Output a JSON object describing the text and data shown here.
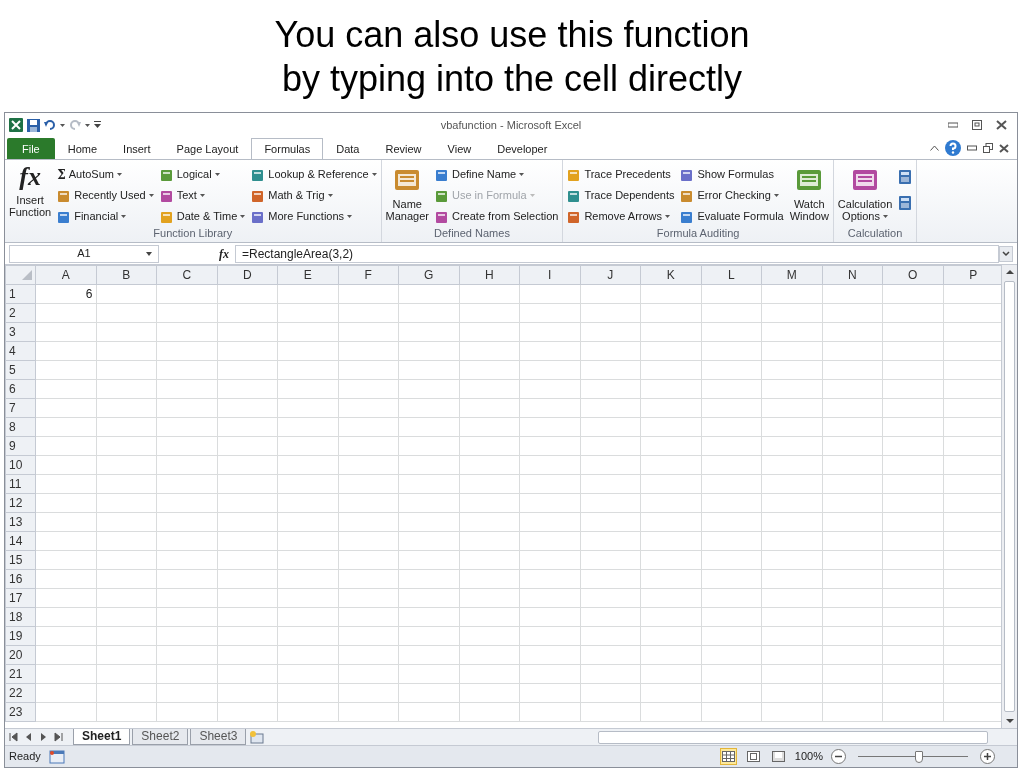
{
  "slide_title_lines": [
    "You can also use this function",
    "by typing into the cell directly"
  ],
  "window": {
    "title": "vbafunction  -  Microsoft Excel"
  },
  "tabs": [
    {
      "label": "File",
      "kind": "file",
      "selected": false
    },
    {
      "label": "Home",
      "kind": "tab",
      "selected": false
    },
    {
      "label": "Insert",
      "kind": "tab",
      "selected": false
    },
    {
      "label": "Page Layout",
      "kind": "tab",
      "selected": false
    },
    {
      "label": "Formulas",
      "kind": "tab",
      "selected": true
    },
    {
      "label": "Data",
      "kind": "tab",
      "selected": false
    },
    {
      "label": "Review",
      "kind": "tab",
      "selected": false
    },
    {
      "label": "View",
      "kind": "tab",
      "selected": false
    },
    {
      "label": "Developer",
      "kind": "tab",
      "selected": false
    }
  ],
  "ribbon_groups": [
    {
      "label": "Function Library",
      "columns": [
        {
          "kind": "large",
          "glyph": "fx",
          "lines": [
            "Insert",
            "Function"
          ],
          "dropdown": false
        },
        {
          "kind": "small",
          "items": [
            {
              "kind": "button",
              "glyph": "Σ",
              "label": "AutoSum",
              "dropdown": true,
              "disabled": false
            },
            {
              "kind": "button",
              "label": "Recently Used",
              "dropdown": true,
              "disabled": false
            },
            {
              "kind": "button",
              "label": "Financial",
              "dropdown": true,
              "disabled": false
            }
          ]
        },
        {
          "kind": "small",
          "items": [
            {
              "kind": "button",
              "label": "Logical",
              "dropdown": true,
              "disabled": false
            },
            {
              "kind": "button",
              "label": "Text",
              "dropdown": true,
              "disabled": false
            },
            {
              "kind": "button",
              "label": "Date & Time",
              "dropdown": true,
              "disabled": false
            }
          ]
        },
        {
          "kind": "small",
          "items": [
            {
              "kind": "button",
              "label": "Lookup & Reference",
              "dropdown": true,
              "disabled": false
            },
            {
              "kind": "button",
              "label": "Math & Trig",
              "dropdown": true,
              "disabled": false
            },
            {
              "kind": "button",
              "label": "More Functions",
              "dropdown": true,
              "disabled": false
            }
          ]
        }
      ]
    },
    {
      "label": "Defined Names",
      "columns": [
        {
          "kind": "large",
          "lines": [
            "Name",
            "Manager"
          ],
          "dropdown": false
        },
        {
          "kind": "small",
          "items": [
            {
              "kind": "button",
              "label": "Define Name",
              "dropdown": true,
              "disabled": false
            },
            {
              "kind": "button",
              "label": "Use in Formula",
              "dropdown": true,
              "disabled": true
            },
            {
              "kind": "button",
              "label": "Create from Selection",
              "dropdown": false,
              "disabled": false
            }
          ]
        }
      ]
    },
    {
      "label": "Formula Auditing",
      "columns": [
        {
          "kind": "small",
          "items": [
            {
              "kind": "button",
              "label": "Trace Precedents",
              "dropdown": false,
              "disabled": false
            },
            {
              "kind": "button",
              "label": "Trace Dependents",
              "dropdown": false,
              "disabled": false
            },
            {
              "kind": "button",
              "label": "Remove Arrows",
              "dropdown": true,
              "disabled": false
            }
          ]
        },
        {
          "kind": "small",
          "items": [
            {
              "kind": "button",
              "label": "Show Formulas",
              "dropdown": false,
              "disabled": false
            },
            {
              "kind": "button",
              "label": "Error Checking",
              "dropdown": true,
              "disabled": false
            },
            {
              "kind": "button",
              "label": "Evaluate Formula",
              "dropdown": false,
              "disabled": false
            }
          ]
        },
        {
          "kind": "large",
          "lines": [
            "Watch",
            "Window"
          ],
          "dropdown": false
        }
      ]
    },
    {
      "label": "Calculation",
      "columns": [
        {
          "kind": "large",
          "lines": [
            "Calculation",
            "Options"
          ],
          "dropdown": true
        },
        {
          "kind": "small",
          "items": [
            {
              "kind": "icon"
            },
            {
              "kind": "icon"
            }
          ]
        }
      ]
    }
  ],
  "formula_bar": {
    "name_box": "A1",
    "fx": "fx",
    "formula": "=RectangleArea(3,2)"
  },
  "columns": [
    "A",
    "B",
    "C",
    "D",
    "E",
    "F",
    "G",
    "H",
    "I",
    "J",
    "K",
    "L",
    "M",
    "N",
    "O",
    "P"
  ],
  "rows": [
    {
      "label": "1",
      "values": [
        "6"
      ]
    },
    {
      "label": "2"
    },
    {
      "label": "3"
    },
    {
      "label": "4"
    },
    {
      "label": "5"
    },
    {
      "label": "6"
    },
    {
      "label": "7"
    },
    {
      "label": "8"
    },
    {
      "label": "9"
    },
    {
      "label": "10"
    },
    {
      "label": "11"
    },
    {
      "label": "12"
    },
    {
      "label": "13"
    },
    {
      "label": "14"
    },
    {
      "label": "15"
    },
    {
      "label": "16"
    },
    {
      "label": "17"
    },
    {
      "label": "18"
    },
    {
      "label": "19"
    },
    {
      "label": "20"
    },
    {
      "label": "21"
    },
    {
      "label": "22"
    },
    {
      "label": "23"
    }
  ],
  "sheet_tabs": [
    {
      "label": "Sheet1",
      "selected": true
    },
    {
      "label": "Sheet2",
      "selected": false
    },
    {
      "label": "Sheet3",
      "selected": false
    }
  ],
  "status_bar": {
    "status": "Ready",
    "views": [
      {
        "kind": "normal",
        "selected": true
      },
      {
        "kind": "page_layout",
        "selected": false
      },
      {
        "kind": "page_break",
        "selected": false
      }
    ],
    "zoom": "100%",
    "zoom_level": {
      "level": 0.55
    }
  }
}
